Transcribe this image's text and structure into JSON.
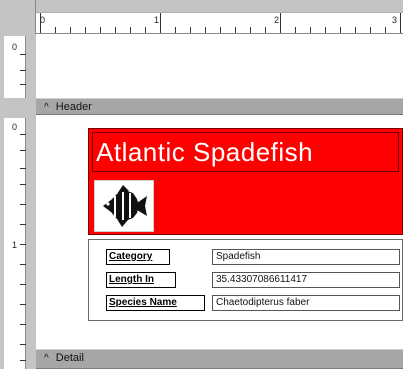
{
  "ruler": {
    "top_labels": [
      "0",
      "1",
      "2",
      "3"
    ],
    "left_labels": [
      "0",
      "0",
      "1"
    ]
  },
  "sections": {
    "header_label": "Header",
    "detail_label": "Detail",
    "caret": "^"
  },
  "report": {
    "title": "Atlantic Spadefish",
    "image_icon": "fish-icon",
    "fields": [
      {
        "label": "Category",
        "value": "Spadefish"
      },
      {
        "label": "Length In",
        "value": "35.43307086611417"
      },
      {
        "label": "Species Name",
        "value": "Chaetodipterus faber"
      }
    ]
  },
  "colors": {
    "title_background": "#ff0000",
    "section_bar": "#a6a6a6"
  }
}
